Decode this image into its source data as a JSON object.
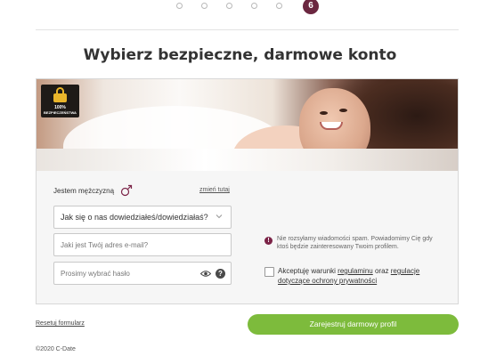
{
  "stepper": {
    "steps": [
      "",
      "",
      "",
      "",
      "",
      "6"
    ],
    "active_label": "6",
    "active_color": "#6b2740"
  },
  "page": {
    "title": "Wybierz bezpieczne, darmowe konto"
  },
  "hero": {
    "badge_line1": "100%",
    "badge_line2": "BEZPIECZEŃSTWA",
    "badge_icon": "lock-icon"
  },
  "form": {
    "gender_label": "Jestem mężczyzną",
    "gender_icon": "male-icon",
    "change_link": "zmień tutaj",
    "source_select_value": "Jak się o nas dowiedziałeś/dowiedziałaś?",
    "email_placeholder": "Jaki jest Twój adres e-mail?",
    "password_placeholder": "Prosimy wybrać hasło",
    "help_symbol": "?",
    "info_symbol": "!",
    "info_text": "Nie rozsyłamy wiadomości spam. Powiadomimy Cię gdy ktoś będzie zainteresowany Twoim profilem.",
    "terms_prefix": "Akceptuję warunki",
    "terms_link1": "regulaminu",
    "terms_middle": "oraz",
    "terms_link2": "regulacje dotyczące ochrony prywatności"
  },
  "footer": {
    "reset_link": "Resetuj formularz",
    "register_button": "Zarejestruj darmowy profil",
    "register_color": "#7dbb3c",
    "copyright": "©2020 C-Date"
  }
}
